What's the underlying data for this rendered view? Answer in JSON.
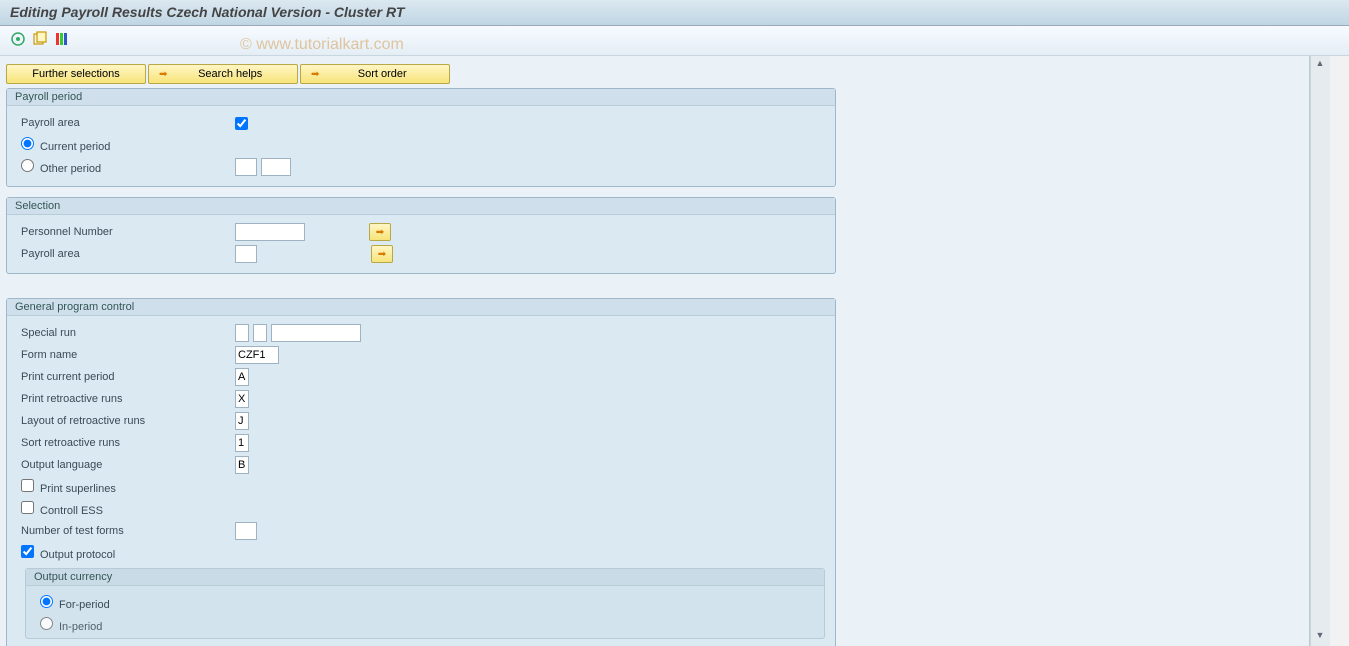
{
  "title": "Editing Payroll Results Czech National Version - Cluster RT",
  "watermark": "© www.tutorialkart.com",
  "topButtons": {
    "further": "Further selections",
    "search": "Search helps",
    "sort": "Sort order"
  },
  "groups": {
    "payrollPeriod": {
      "title": "Payroll period",
      "payrollArea": {
        "label": "Payroll area",
        "checked": true
      },
      "currentPeriod": {
        "label": "Current period",
        "selected": true
      },
      "otherPeriod": {
        "label": "Other period",
        "selected": false,
        "val1": "",
        "val2": ""
      }
    },
    "selection": {
      "title": "Selection",
      "personnel": {
        "label": "Personnel Number",
        "value": ""
      },
      "payrollArea": {
        "label": "Payroll area",
        "value": ""
      }
    },
    "general": {
      "title": "General program control",
      "specialRun": {
        "label": "Special run",
        "val1": "",
        "val2": ""
      },
      "formName": {
        "label": "Form name",
        "value": "CZF1"
      },
      "printCurrent": {
        "label": "Print current period",
        "value": "A"
      },
      "printRetro": {
        "label": "Print retroactive runs",
        "value": "X"
      },
      "layoutRetro": {
        "label": "Layout of retroactive runs",
        "value": "J"
      },
      "sortRetro": {
        "label": "Sort retroactive runs",
        "value": "1"
      },
      "outputLang": {
        "label": "Output language",
        "value": "B"
      },
      "printSuperlines": {
        "label": "Print superlines",
        "checked": false
      },
      "controllEss": {
        "label": "Controll  ESS",
        "checked": false
      },
      "numTestForms": {
        "label": "Number of test forms",
        "value": ""
      },
      "outputProtocol": {
        "label": "Output protocol",
        "checked": true
      },
      "outputCurrency": {
        "title": "Output currency",
        "forPeriod": {
          "label": "For-period",
          "selected": true
        },
        "inPeriod": {
          "label": "In-period",
          "selected": false
        }
      }
    }
  }
}
